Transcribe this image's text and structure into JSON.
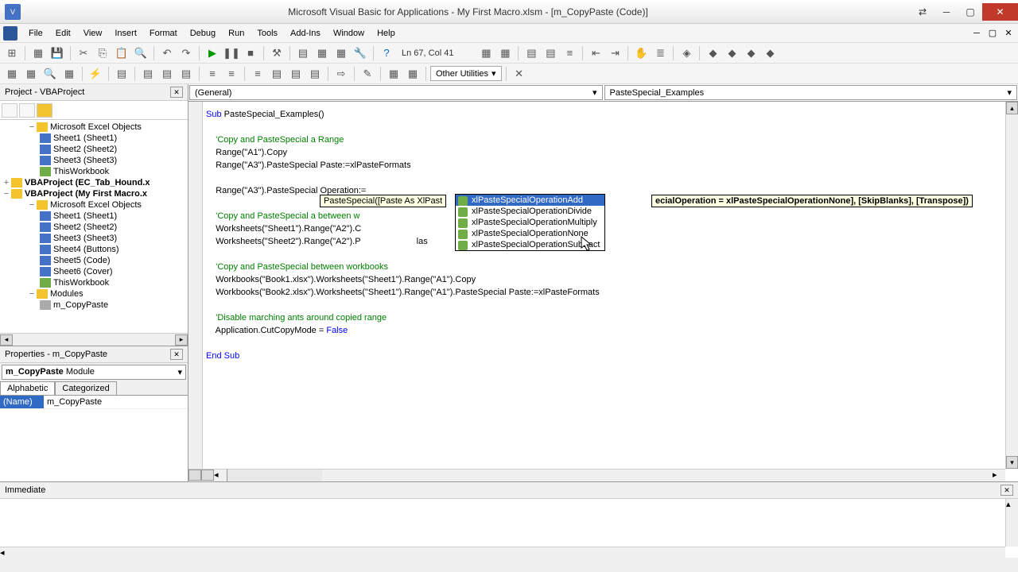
{
  "title": "Microsoft Visual Basic for Applications - My First Macro.xlsm - [m_CopyPaste (Code)]",
  "menu": [
    "File",
    "Edit",
    "View",
    "Insert",
    "Format",
    "Debug",
    "Run",
    "Tools",
    "Add-Ins",
    "Window",
    "Help"
  ],
  "status": "Ln 67, Col 41",
  "other_util": "Other Utilities",
  "project_title": "Project - VBAProject",
  "tree": {
    "excel_objects": "Microsoft Excel Objects",
    "s1": "Sheet1 (Sheet1)",
    "s2": "Sheet2 (Sheet2)",
    "s3": "Sheet3 (Sheet3)",
    "tw": "ThisWorkbook",
    "vba1": "VBAProject (EC_Tab_Hound.x",
    "vba2": "VBAProject (My First Macro.x",
    "s4": "Sheet4 (Buttons)",
    "s5": "Sheet5 (Code)",
    "s6": "Sheet6 (Cover)",
    "modules": "Modules",
    "mod1": "m_CopyPaste",
    "mod2": ""
  },
  "props": {
    "title": "Properties - m_CopyPaste",
    "combo_name": "m_CopyPaste",
    "combo_type": "Module",
    "tab1": "Alphabetic",
    "tab2": "Categorized",
    "row_name": "(Name)",
    "row_val": "m_CopyPaste"
  },
  "code_dropdowns": {
    "left": "(General)",
    "right": "PasteSpecial_Examples"
  },
  "code": {
    "l1": "Sub PasteSpecial_Examples()",
    "l1a": "Sub",
    "l1b": " PasteSpecial_Examples()",
    "l3": "    'Copy and PasteSpecial a Range",
    "l4": "    Range(\"A1\").Copy",
    "l5": "    Range(\"A3\").PasteSpecial Paste:=xlPasteFormats",
    "l7": "    Range(\"A3\").PasteSpecial Operation:=",
    "l9": "    'Copy and PasteSpecial a between w",
    "l10": "    Worksheets(\"Sheet1\").Range(\"A2\").C",
    "l11": "    Worksheets(\"Sheet2\").Range(\"A2\").P                       las",
    "l13": "    'Copy and PasteSpecial between workbooks",
    "l14": "    Workbooks(\"Book1.xlsx\").Worksheets(\"Sheet1\").Range(\"A1\").Copy",
    "l15": "    Workbooks(\"Book2.xlsx\").Worksheets(\"Sheet1\").Range(\"A1\").PasteSpecial Paste:=xlPasteFormats",
    "l17": "    'Disable marching ants around copied range",
    "l18a": "    Application.CutCopyMode = ",
    "l18b": "False",
    "l20a": "End Sub"
  },
  "intellisense": {
    "tip_left": "PasteSpecial([Paste As XlPast",
    "tip_right": "ecialOperation = xlPasteSpecialOperationNone], [SkipBlanks], [Transpose])",
    "items": [
      "xlPasteSpecialOperationAdd",
      "xlPasteSpecialOperationDivide",
      "xlPasteSpecialOperationMultiply",
      "xlPasteSpecialOperationNone",
      "xlPasteSpecialOperationSubtract"
    ]
  },
  "immediate_title": "Immediate"
}
